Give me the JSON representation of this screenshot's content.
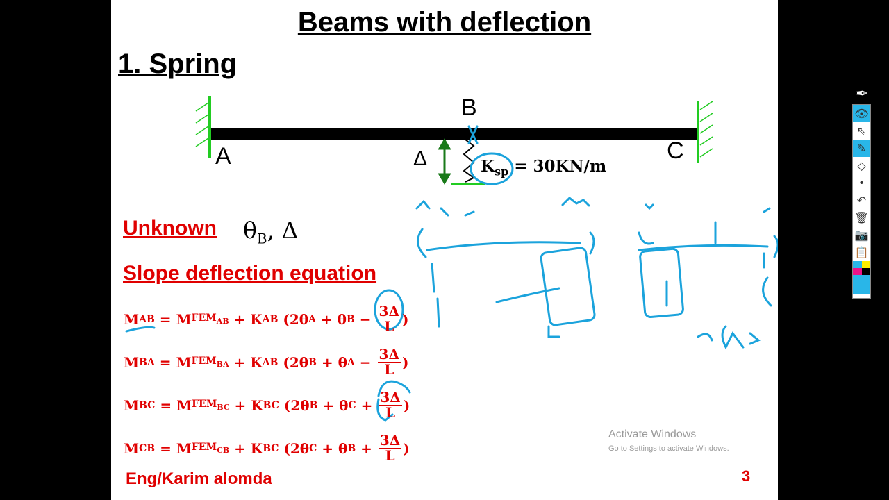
{
  "slide": {
    "title": "Beams with deflection",
    "subtitle": "1. Spring",
    "diagram": {
      "label_a": "A",
      "label_b": "B",
      "label_c": "C",
      "delta": "Δ",
      "ksp_sym": "K",
      "ksp_sub": "sp",
      "ksp_value": "= 30KN/m",
      "beam_color": "#000000",
      "support_color": "#22cc22",
      "arrow_color": "#1a7a1a"
    },
    "unknown_label": "Unknown",
    "unknown_theta": "θ",
    "unknown_sub": "B",
    "unknown_rest": ", Δ",
    "sde_label": "Slope deflection equation",
    "equations": [
      {
        "m": "M",
        "lhs": "AB",
        "eq": " = M",
        "fem": "FEM",
        "fsub": "AB",
        "plus": " + K",
        "ksub": "AB",
        "open": " (2θ",
        "t1": "A",
        "mid": " + θ",
        "t2": "B",
        "sign": " − ",
        "num": "3Δ",
        "den": "L",
        "close": ")"
      },
      {
        "m": "M",
        "lhs": "BA",
        "eq": " = M",
        "fem": "FEM",
        "fsub": "BA",
        "plus": " + K",
        "ksub": "AB",
        "open": " (2θ",
        "t1": "B",
        "mid": " + θ",
        "t2": "A",
        "sign": " − ",
        "num": "3Δ",
        "den": "L",
        "close": ")"
      },
      {
        "m": "M",
        "lhs": "BC",
        "eq": " = M",
        "fem": "FEM",
        "fsub": "BC",
        "plus": " + K",
        "ksub": "BC",
        "open": " (2θ",
        "t1": "B",
        "mid": " + θ",
        "t2": "C",
        "sign": " + ",
        "num": "3Δ",
        "den": "L",
        "close": ")"
      },
      {
        "m": "M",
        "lhs": "CB",
        "eq": " = M",
        "fem": "FEM",
        "fsub": "CB",
        "plus": " + K",
        "ksub": "BC",
        "open": " (2θ",
        "t1": "C",
        "mid": " + θ",
        "t2": "B",
        "sign": " + ",
        "num": "3Δ",
        "den": "L",
        "close": ")"
      }
    ],
    "author": "Eng/Karim alomda",
    "page_number": "3",
    "text_color": "#e00000",
    "ink_color": "#1ba3dc"
  },
  "watermark": {
    "line1": "Activate Windows",
    "line2": "Go to Settings to activate Windows."
  },
  "toolbar": {
    "tools": [
      "pen-icon",
      "eye-icon",
      "pointer-icon",
      "highlighter-icon",
      "eraser-icon",
      "dot-icon",
      "undo-icon",
      "trash-icon",
      "camera-icon",
      "clipboard-icon"
    ],
    "colors": [
      "#29b6e8",
      "#ffee00",
      "#ee1188",
      "#000000"
    ]
  }
}
